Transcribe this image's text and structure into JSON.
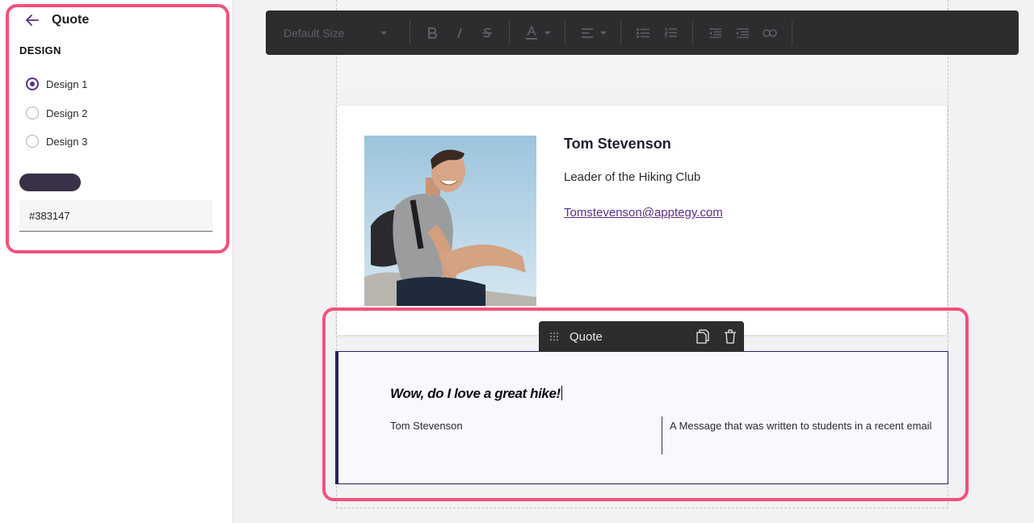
{
  "sidebar": {
    "title": "Quote",
    "section_label": "DESIGN",
    "designs": [
      {
        "label": "Design 1",
        "selected": true
      },
      {
        "label": "Design 2",
        "selected": false
      },
      {
        "label": "Design 3",
        "selected": false
      }
    ],
    "color_value": "#383147"
  },
  "toolbar": {
    "font_size_label": "Default Size",
    "icons": [
      "chevron-down-icon",
      "bold-icon",
      "italic-icon",
      "strikethrough-icon",
      "text-color-icon",
      "align-icon",
      "bullet-list-icon",
      "numbered-list-icon",
      "outdent-icon",
      "indent-icon",
      "link-icon"
    ]
  },
  "profile": {
    "name": "Tom Stevenson",
    "role": "Leader of the Hiking Club",
    "email": "Tomstevenson@apptegy.com"
  },
  "quote": {
    "tab_label": "Quote",
    "text": "Wow, do I love a great hike!",
    "author": "Tom Stevenson",
    "context": "A Message that was written to students in a recent email"
  },
  "colors": {
    "accent": "#5a2f82",
    "highlight": "#f0527a",
    "swatch": "#383147",
    "toolbar_bg": "#2d2d30"
  }
}
